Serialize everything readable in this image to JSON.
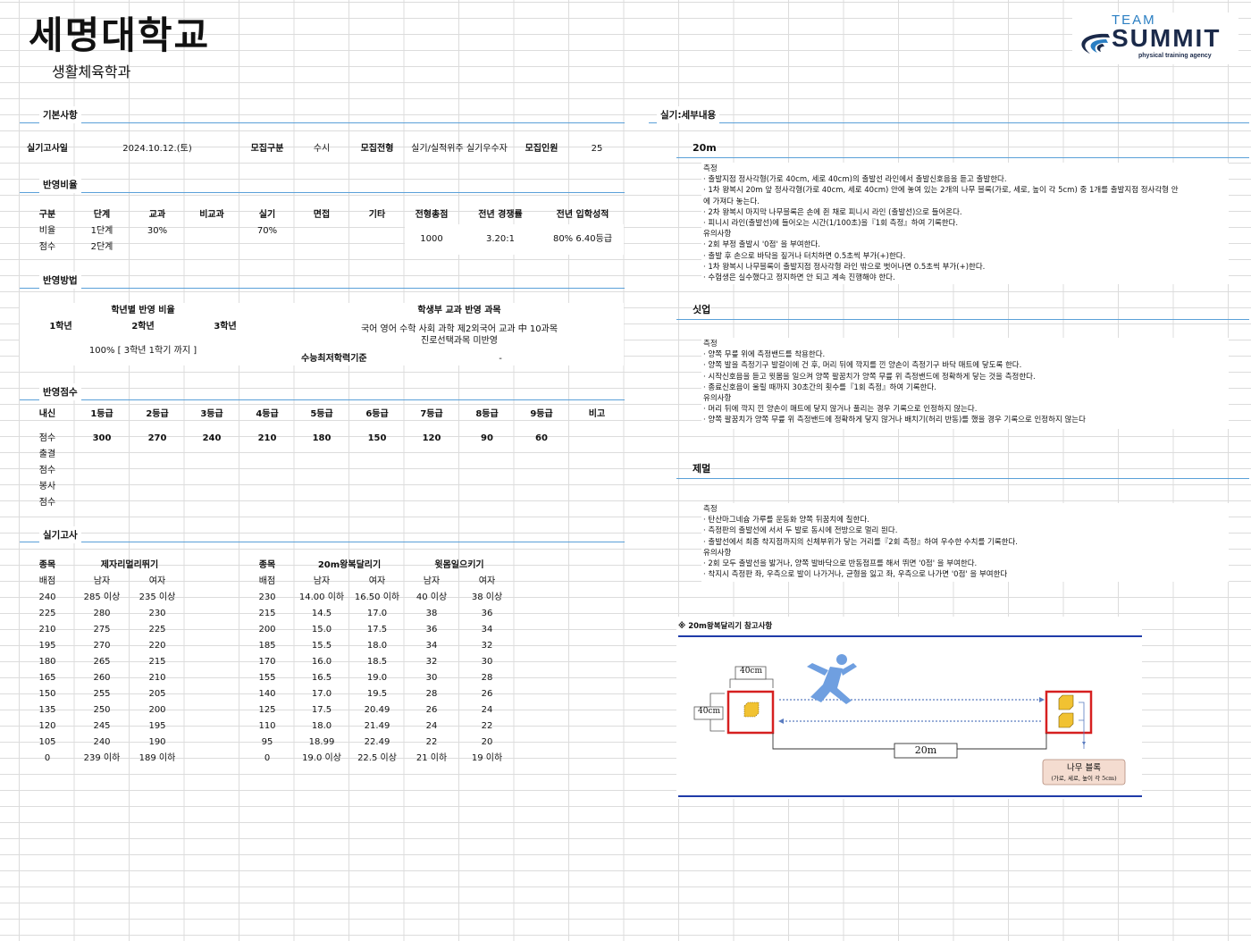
{
  "header": {
    "university": "세명대학교",
    "department": "생활체육학과",
    "logo": {
      "top": "TEAM",
      "main": "SUMMIT",
      "tagline": "physical training agency"
    }
  },
  "basic": {
    "section": "기본사항",
    "exam_date_label": "실기고사일",
    "exam_date": "2024.10.12.(토)",
    "category_label": "모집구분",
    "category": "수시",
    "type_label": "모집전형",
    "type": "실기/실적위주 실기우수자",
    "quota_label": "모집인원",
    "quota": "25"
  },
  "ratio": {
    "section": "반영비율",
    "headers": [
      "구분",
      "단계",
      "교과",
      "비교과",
      "실기",
      "면접",
      "기타",
      "전형총점",
      "전년 경쟁률",
      "전년 입학성적"
    ],
    "row1": [
      "비율",
      "1단계",
      "30%",
      "",
      "70%"
    ],
    "row2": [
      "점수",
      "2단계"
    ],
    "total": "1000",
    "competition": "3.20:1",
    "prev_score": "80% 6.40등급"
  },
  "method": {
    "section": "반영방법",
    "grade_ratio_label": "학년별 반영 비율",
    "years": [
      "1학년",
      "2학년",
      "3학년"
    ],
    "year_ratio": "100% [ 3학년 1학기 까지 ]",
    "subjects_label": "학생부 교과 반영 과목",
    "subjects_line1": "국어 영어 수학 사회 과학 제2외국어 교과 中 10과목",
    "subjects_line2": "진로선택과목 미반영",
    "min_label": "수능최저학력기준",
    "min_value": "-"
  },
  "scores": {
    "section": "반영점수",
    "headers": [
      "내신",
      "1등급",
      "2등급",
      "3등급",
      "4등급",
      "5등급",
      "6등급",
      "7등급",
      "8등급",
      "9등급",
      "비고"
    ],
    "score_label": "점수",
    "values": [
      "300",
      "270",
      "240",
      "210",
      "180",
      "150",
      "120",
      "90",
      "60"
    ],
    "rows": [
      "출결",
      "점수",
      "봉사",
      "점수"
    ]
  },
  "practical": {
    "section": "실기고사",
    "event_label": "종목",
    "points_label": "배점",
    "male": "남자",
    "female": "여자",
    "event1": "제자리멀리뛰기",
    "event2": "20m왕복달리기",
    "event3": "윗몸일으키기",
    "rows1": [
      [
        "240",
        "285 이상",
        "235 이상"
      ],
      [
        "225",
        "280",
        "230"
      ],
      [
        "210",
        "275",
        "225"
      ],
      [
        "195",
        "270",
        "220"
      ],
      [
        "180",
        "265",
        "215"
      ],
      [
        "165",
        "260",
        "210"
      ],
      [
        "150",
        "255",
        "205"
      ],
      [
        "135",
        "250",
        "200"
      ],
      [
        "120",
        "245",
        "195"
      ],
      [
        "105",
        "240",
        "190"
      ],
      [
        "0",
        "239 이하",
        "189 이하"
      ]
    ],
    "rows2": [
      [
        "230",
        "14.00 이하",
        "16.50 이하",
        "40 이상",
        "38 이상"
      ],
      [
        "215",
        "14.5",
        "17.0",
        "38",
        "36"
      ],
      [
        "200",
        "15.0",
        "17.5",
        "36",
        "34"
      ],
      [
        "185",
        "15.5",
        "18.0",
        "34",
        "32"
      ],
      [
        "170",
        "16.0",
        "18.5",
        "32",
        "30"
      ],
      [
        "155",
        "16.5",
        "19.0",
        "30",
        "28"
      ],
      [
        "140",
        "17.0",
        "19.5",
        "28",
        "26"
      ],
      [
        "125",
        "17.5",
        "20.49",
        "26",
        "24"
      ],
      [
        "110",
        "18.0",
        "21.49",
        "24",
        "22"
      ],
      [
        "95",
        "18.99",
        "22.49",
        "22",
        "20"
      ],
      [
        "0",
        "19.0 이상",
        "22.5 이상",
        "21 이하",
        "19 이하"
      ]
    ]
  },
  "details": {
    "section": "실기:세부내용",
    "e1_title": "20m",
    "e1_lines": [
      "측정",
      "· 출발지점 정사각형(가로 40cm, 세로 40cm)의 출발선 라인에서 출발신호음을 듣고 출발한다.",
      "· 1차 왕복시 20m 앞 정사각형(가로 40cm, 세로 40cm) 안에 놓여 있는 2개의 나무 블록(가로, 세로, 높이 각 5cm) 중 1개를 출발지점 정사각형 안",
      "에 가져다 놓는다.",
      "· 2차 왕복시 마지막 나무블록은 손에 쥔 채로 피니시 라인 (출발선)으로 들어온다.",
      "· 피니시 라인(출발선)에 들어오는 시간(1/100초)을『1회 측정』하여 기록한다.",
      "유의사항",
      "· 2회 부정 출발시 '0점' 을 부여한다.",
      "· 출발 후 손으로 바닥을 짚거나 터치하면 0.5초씩 부가(+)한다.",
      "· 1차 왕복시 나무블록이 출발지점 정사각형 라인 밖으로 벗어나면 0.5초씩 부가(+)한다.",
      "· 수험생은 실수했다고 정지하면 안 되고 계속 진행해야 한다."
    ],
    "e2_title": "싯업",
    "e2_lines": [
      "측정",
      "· 양쪽 무릎 위에 측정밴드를 착용한다.",
      "· 양쪽 발을 측정기구 발걸이에 건 후, 머리 뒤에 깍지를 낀 양손이 측정기구 바닥 매트에 닿도록 한다.",
      "· 시작신호음을 듣고 윗몸을 일으켜 양쪽 팔꿈치가 양쪽 무릎 위 측정밴드에 정확하게 닿는 것을 측정한다.",
      "· 종료신호음이 울릴 때까지 30초간의 횟수를『1회 측정』하여 기록한다.",
      "유의사항",
      "· 머리 뒤에 깍지 낀 양손이 매트에 닿지 않거나 풀리는 경우 기록으로 인정하지 않는다.",
      "· 양쪽 팔꿈치가 양쪽 무릎 위 측정밴드에 정확하게 닿지 않거나 배치기(허리 반동)를 했을 경우 기록으로 인정하지 않는다"
    ],
    "e3_title": "제멀",
    "e3_lines": [
      "측정",
      "· 탄산마그네슘 가루를 운동화 양쪽 뒤꿈치에 칠한다.",
      "· 측정판의 출발선에 서서 두 발로 동시에 전방으로 멀리 뛴다.",
      "· 출발선에서 최종 착지점까지의 신체부위가 닿는 거리를『2회 측정』하여 우수한 수치를 기록한다.",
      "유의사항",
      "· 2회 모두 출발선을 밟거나, 양쪽 발바닥으로 반동점프를 해서 뛰면 '0점' 을 부여한다.",
      "· 착지시 측정판 좌, 우측으로 발이 나가거나, 균형을 잃고 좌, 우측으로 나가면 '0점' 을 부여한다"
    ],
    "diagram": {
      "title": "※ 20m왕복달리기 참고사항",
      "w40": "40cm",
      "h40": "40cm",
      "dist": "20m",
      "block_label": "나무 블록",
      "block_desc": "(가로, 세로, 높이 각 5cm)"
    }
  }
}
